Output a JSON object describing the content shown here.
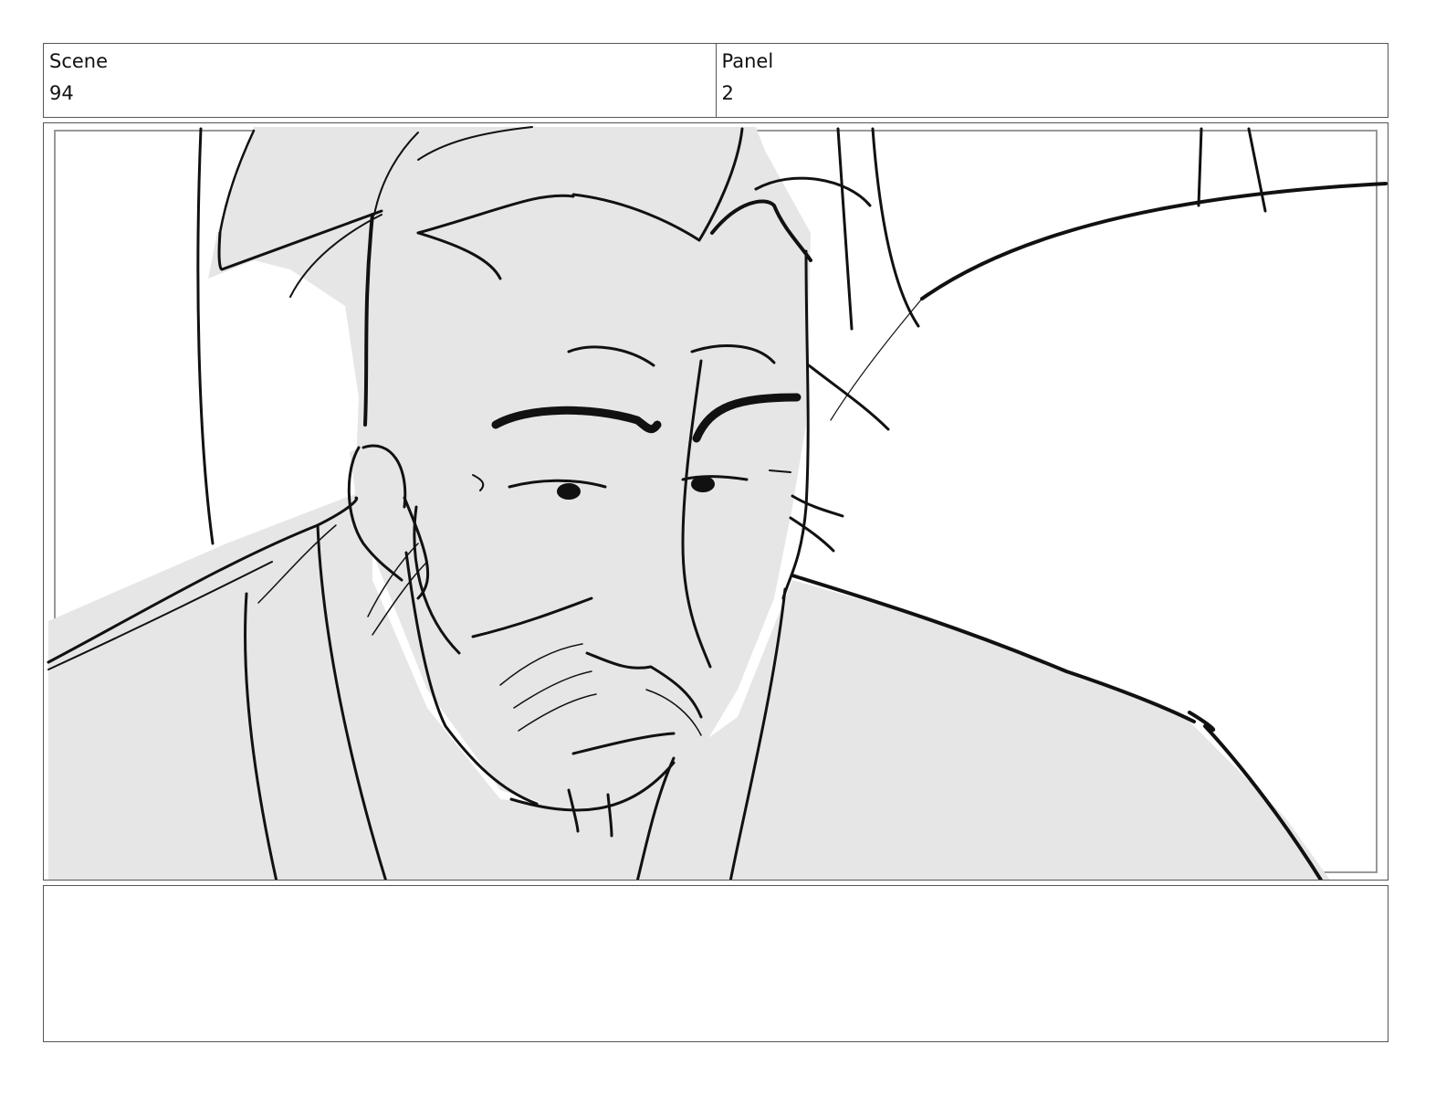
{
  "header": {
    "scene_label": "Scene",
    "scene_value": "94",
    "panel_label": "Panel",
    "panel_value": "2"
  },
  "notes": {
    "text": ""
  },
  "colors": {
    "border": "#555555",
    "sketch_fill": "#e6e6e6",
    "line": "#111111",
    "safe_area": "#999999"
  }
}
